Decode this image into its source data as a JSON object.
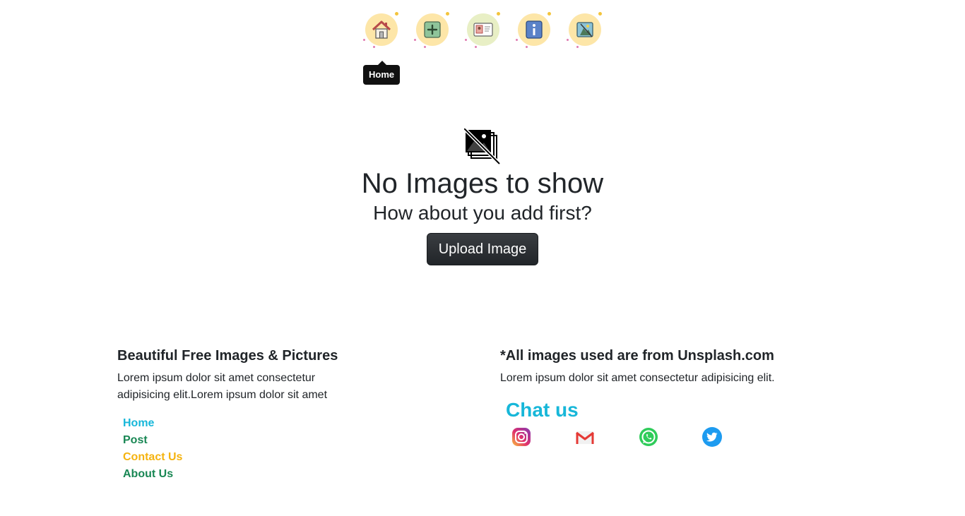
{
  "nav": {
    "items": [
      {
        "icon": "home-icon"
      },
      {
        "icon": "add-post-icon"
      },
      {
        "icon": "contact-card-icon"
      },
      {
        "icon": "info-icon"
      },
      {
        "icon": "gallery-icon"
      }
    ],
    "tooltip": "Home"
  },
  "empty_state": {
    "icon": "no-images-icon",
    "title": "No Images to show",
    "subtitle": "How about you add first?",
    "button_label": "Upload Image"
  },
  "footer": {
    "left": {
      "heading": "Beautiful Free Images & Pictures",
      "text": "Lorem ipsum dolor sit amet consectetur adipisicing elit.Lorem ipsum dolor sit amet",
      "links": [
        {
          "label": "Home",
          "color": "#17b7d9"
        },
        {
          "label": "Post",
          "color": "#198754"
        },
        {
          "label": "Contact Us",
          "color": "#f5b30f"
        },
        {
          "label": "About Us",
          "color": "#198754"
        }
      ]
    },
    "right": {
      "heading": "*All images used are from Unsplash.com",
      "text": "Lorem ipsum dolor sit amet consectetur adipisicing elit.",
      "chat_title": "Chat us",
      "chat_color": "#17b7d9",
      "social": [
        "instagram-icon",
        "gmail-icon",
        "whatsapp-icon",
        "twitter-icon"
      ]
    }
  }
}
